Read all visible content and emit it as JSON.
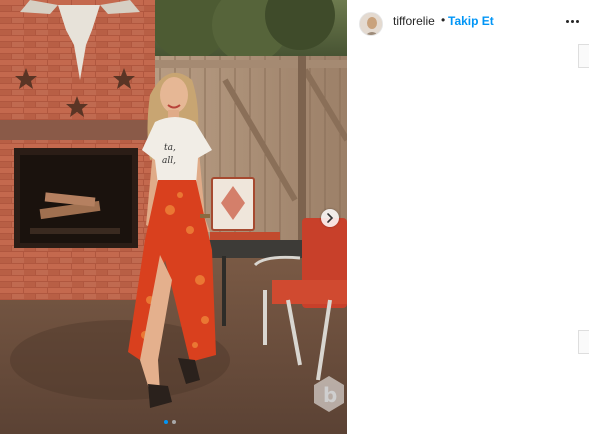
{
  "post": {
    "username": "tifforelie",
    "separator": "•",
    "follow_label": "Takip Et"
  },
  "icons": {
    "more": "more-options-icon",
    "next": "chevron-right-icon",
    "watermark": "watermark-logo-icon"
  },
  "carousel": {
    "slide_count": 2,
    "active_index": 0
  },
  "colors": {
    "follow": "#0095f6",
    "text": "#262626",
    "dot_active": "#0095f6",
    "dot_inactive": "#a8a8a8"
  }
}
